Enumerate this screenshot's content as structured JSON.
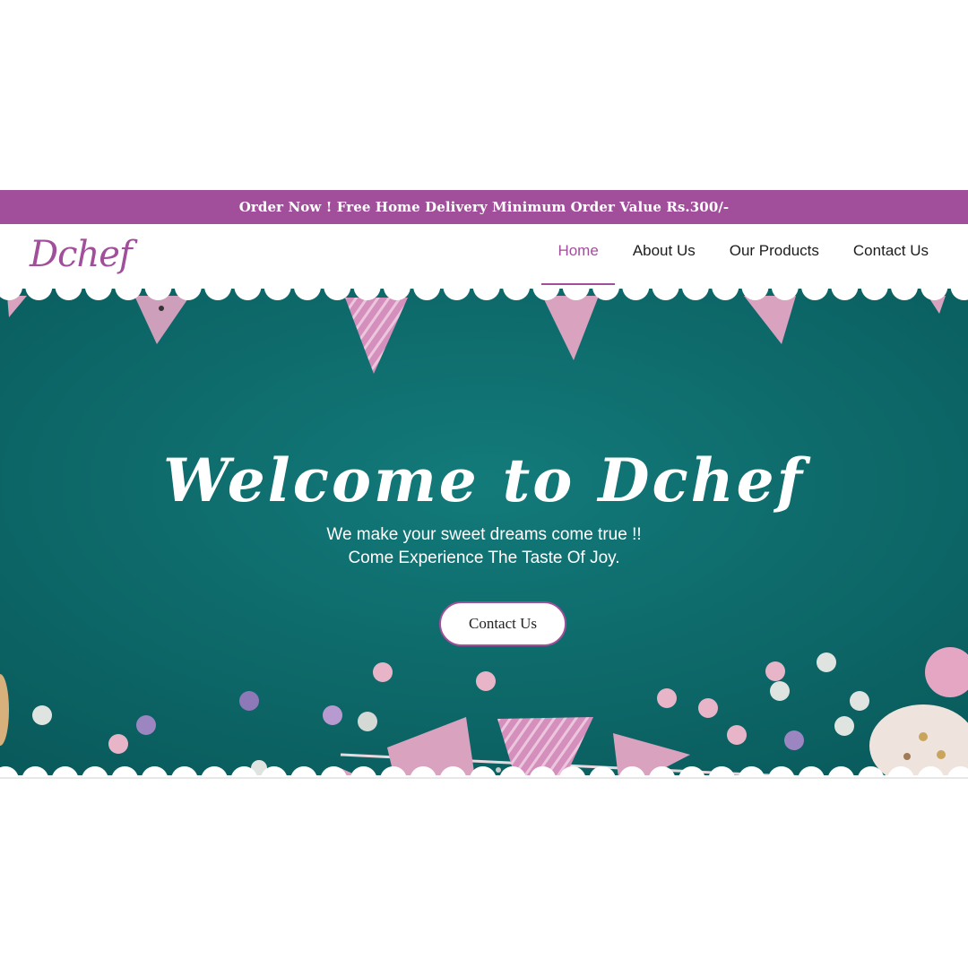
{
  "colors": {
    "accent": "#a14f9a",
    "hero_teal": "#0f7474",
    "hero_teal_dark": "#0a5f5f",
    "pennant_pink": "#d8a3c2",
    "white": "#ffffff"
  },
  "announcement": {
    "text": "Order Now ! Free Home Delivery Minimum Order Value Rs.300/-"
  },
  "brand": {
    "logo_text": "Dchef"
  },
  "nav": {
    "items": [
      {
        "label": "Home",
        "active": true
      },
      {
        "label": "About Us",
        "active": false
      },
      {
        "label": "Our Products",
        "active": false
      },
      {
        "label": "Contact Us",
        "active": false
      }
    ]
  },
  "hero": {
    "title": "Welcome to Dchef",
    "subtitle_line1": "We make your sweet dreams come true !!",
    "subtitle_line2": "Come Experience The Taste Of Joy.",
    "cta_label": "Contact Us"
  },
  "slider": {
    "slide_count": 2,
    "active_index": 1
  }
}
